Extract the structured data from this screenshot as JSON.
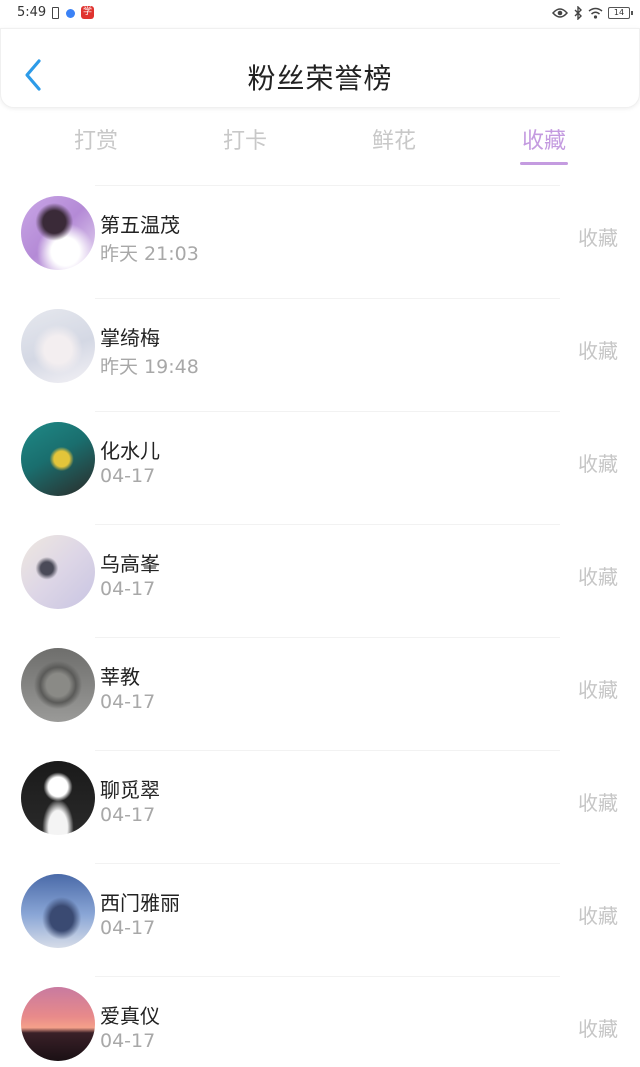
{
  "status_bar": {
    "time": "5:49",
    "app_badge": "学",
    "battery": "14"
  },
  "header": {
    "title": "粉丝荣誉榜",
    "back_icon": "chevron-left-icon"
  },
  "tabs": [
    {
      "label": "打赏",
      "active": false
    },
    {
      "label": "打卡",
      "active": false
    },
    {
      "label": "鲜花",
      "active": false
    },
    {
      "label": "收藏",
      "active": true
    }
  ],
  "colors": {
    "accent": "#c49be0",
    "back_arrow": "#2d9be8",
    "muted": "#c6c6c6"
  },
  "fans": [
    {
      "name": "第五温茂",
      "time": "昨天 21:03",
      "action": "收藏"
    },
    {
      "name": "掌绮梅",
      "time": "昨天 19:48",
      "action": "收藏"
    },
    {
      "name": "化水儿",
      "time": "04-17",
      "action": "收藏"
    },
    {
      "name": "乌高峯",
      "time": "04-17",
      "action": "收藏"
    },
    {
      "name": "莘教",
      "time": "04-17",
      "action": "收藏"
    },
    {
      "name": "聊觅翠",
      "time": "04-17",
      "action": "收藏"
    },
    {
      "name": "西门雅丽",
      "time": "04-17",
      "action": "收藏"
    },
    {
      "name": "爱真仪",
      "time": "04-17",
      "action": "收藏"
    }
  ]
}
